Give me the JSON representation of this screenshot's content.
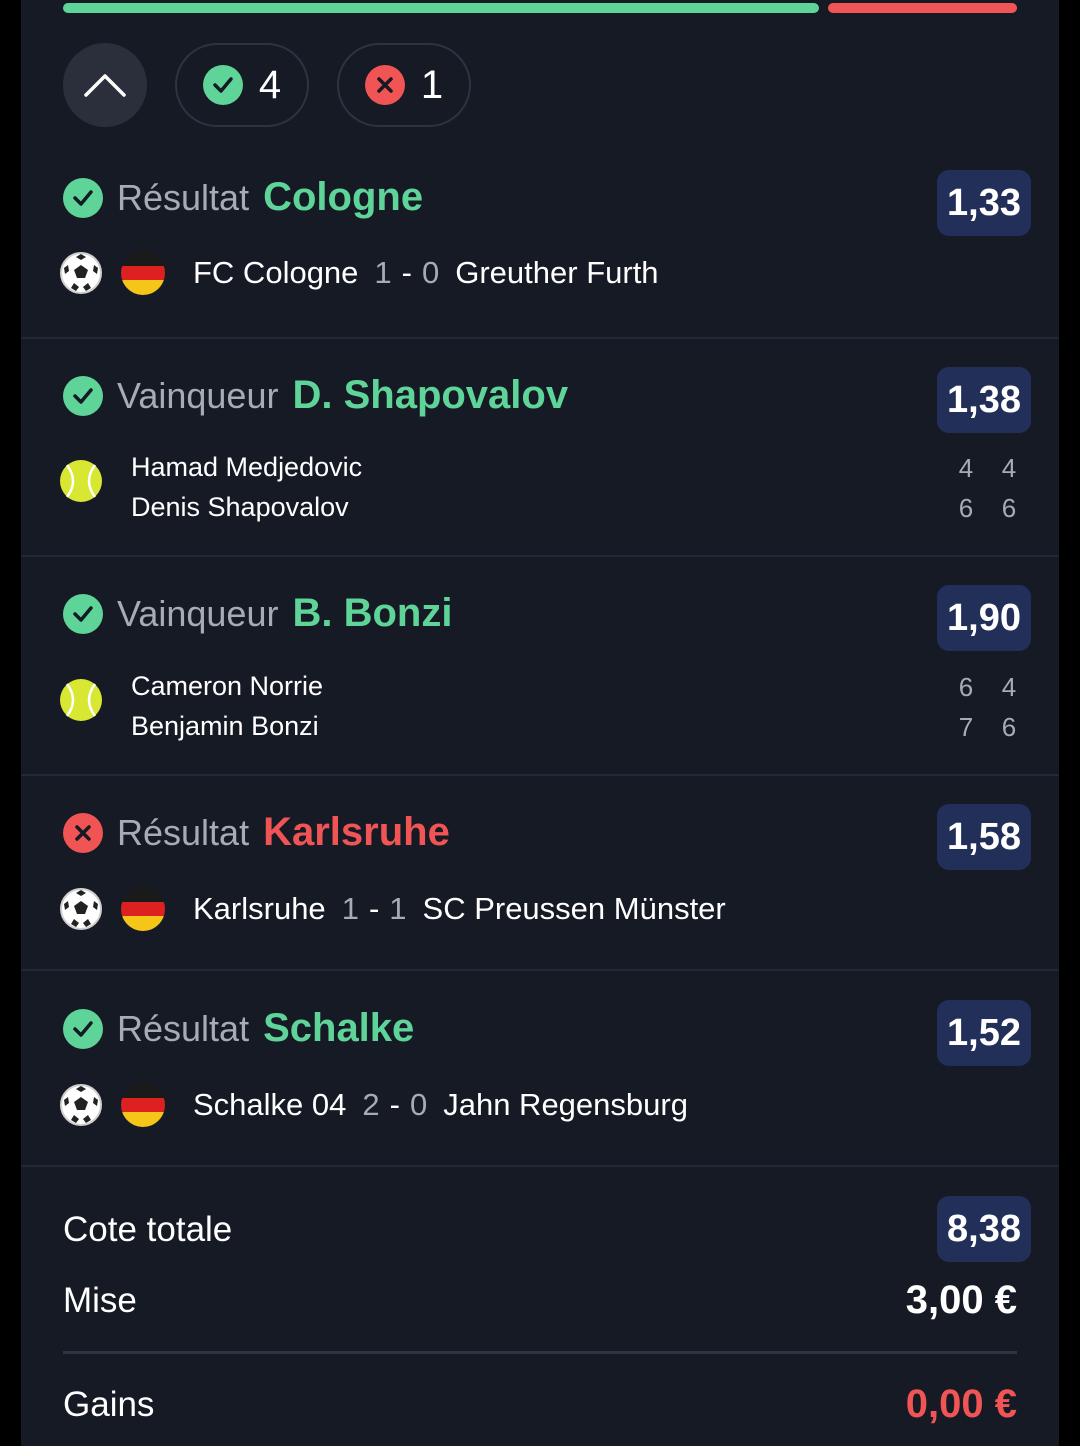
{
  "summary_counts": {
    "won": "4",
    "lost": "1"
  },
  "colors": {
    "win": "#5fd498",
    "loss": "#f05454",
    "odds_bg": "#223059",
    "card_bg": "#161a25"
  },
  "progress": {
    "won_fraction": 0.8,
    "lost_fraction": 0.2
  },
  "selections": [
    {
      "status": "won",
      "status_icon": "check-icon",
      "sport": "football",
      "market": "Résultat",
      "pick": "Cologne",
      "odds": "1,33",
      "home": "FC Cologne",
      "home_score": "1",
      "separator": "-",
      "away_score": "0",
      "away": "Greuther Furth"
    },
    {
      "status": "won",
      "status_icon": "check-icon",
      "sport": "tennis",
      "market": "Vainqueur",
      "pick": "D. Shapovalov",
      "odds": "1,38",
      "player1": "Hamad Medjedovic",
      "player2": "Denis Shapovalov",
      "p1_sets": [
        "4",
        "4"
      ],
      "p2_sets": [
        "6",
        "6"
      ]
    },
    {
      "status": "won",
      "status_icon": "check-icon",
      "sport": "tennis",
      "market": "Vainqueur",
      "pick": "B. Bonzi",
      "odds": "1,90",
      "player1": "Cameron Norrie",
      "player2": "Benjamin Bonzi",
      "p1_sets": [
        "6",
        "4"
      ],
      "p2_sets": [
        "7",
        "6"
      ]
    },
    {
      "status": "lost",
      "status_icon": "cross-icon",
      "sport": "football",
      "market": "Résultat",
      "pick": "Karlsruhe",
      "odds": "1,58",
      "home": "Karlsruhe",
      "home_score": "1",
      "separator": "-",
      "away_score": "1",
      "away": "SC Preussen Münster"
    },
    {
      "status": "won",
      "status_icon": "check-icon",
      "sport": "football",
      "market": "Résultat",
      "pick": "Schalke",
      "odds": "1,52",
      "home": "Schalke 04",
      "home_score": "2",
      "separator": "-",
      "away_score": "0",
      "away": "Jahn Regensburg"
    }
  ],
  "totals": {
    "total_odds_label": "Cote totale",
    "total_odds": "8,38",
    "stake_label": "Mise",
    "stake": "3,00 €",
    "winnings_label": "Gains",
    "winnings": "0,00 €"
  }
}
